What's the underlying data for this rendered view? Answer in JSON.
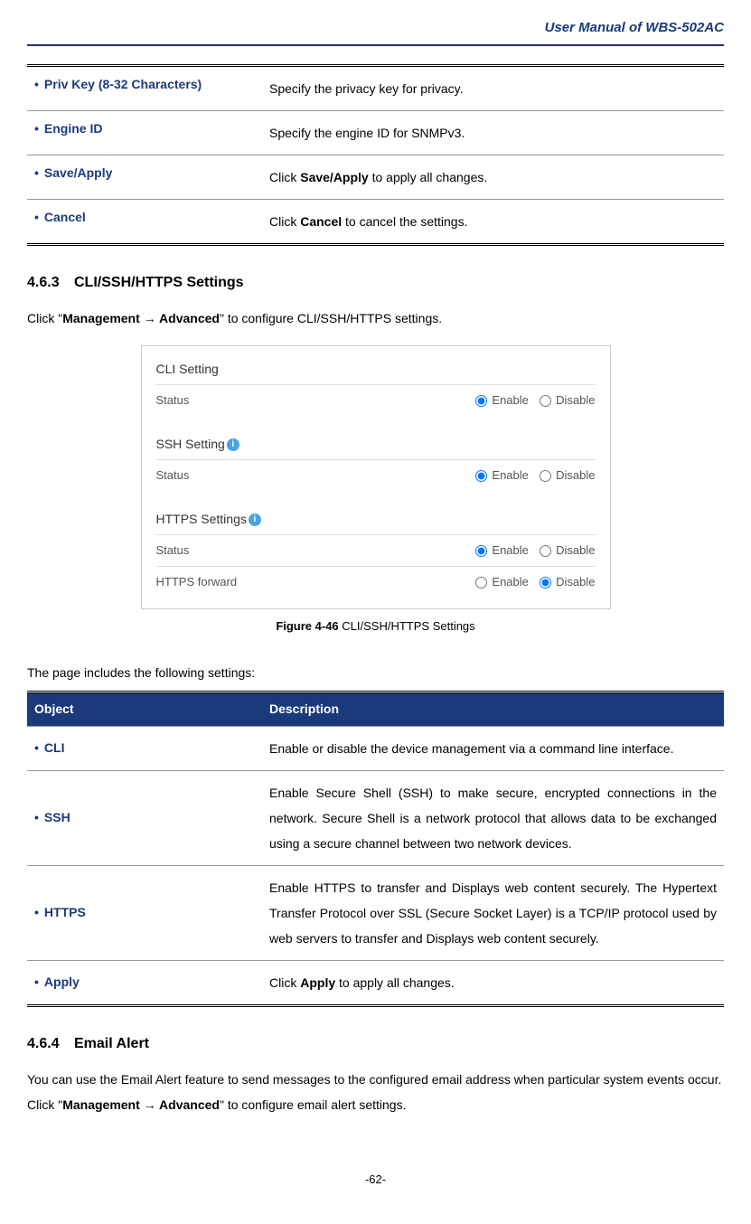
{
  "header": {
    "title": "User Manual of WBS-502AC"
  },
  "topTable": {
    "rows": [
      {
        "obj": "Priv Key (8-32 Characters)",
        "desc_pre": "Specify the privacy key for privacy.",
        "desc_bold": "",
        "desc_post": ""
      },
      {
        "obj": "Engine ID",
        "desc_pre": "Specify the engine ID for SNMPv3.",
        "desc_bold": "",
        "desc_post": ""
      },
      {
        "obj": "Save/Apply",
        "desc_pre": "Click ",
        "desc_bold": "Save/Apply",
        "desc_post": " to apply all changes."
      },
      {
        "obj": "Cancel",
        "desc_pre": "Click ",
        "desc_bold": "Cancel",
        "desc_post": " to cancel the settings."
      }
    ]
  },
  "section463": {
    "num": "4.6.3",
    "title": "CLI/SSH/HTTPS Settings",
    "intro_pre": "Click \"",
    "intro_nav1": "Management ",
    "intro_arrow": "→",
    "intro_nav2": " Advanced",
    "intro_post": "\" to configure CLI/SSH/HTTPS settings."
  },
  "figure": {
    "cli_title": "CLI Setting",
    "ssh_title": "SSH Setting",
    "https_title": "HTTPS Settings",
    "status_label": "Status",
    "forward_label": "HTTPS forward",
    "enable": "Enable",
    "disable": "Disable",
    "caption_bold": "Figure 4-46",
    "caption_rest": " CLI/SSH/HTTPS Settings"
  },
  "settingsIntro": "The page includes the following settings:",
  "objTable": {
    "h1": "Object",
    "h2": "Description",
    "rows": [
      {
        "obj": "CLI",
        "desc_pre": "Enable or disable the device management via a command line interface.",
        "desc_bold": "",
        "desc_post": ""
      },
      {
        "obj": "SSH",
        "desc_pre": "Enable Secure Shell (SSH) to make secure, encrypted connections in the network. Secure Shell is a network protocol that allows data to be exchanged using a secure channel between two network devices.",
        "desc_bold": "",
        "desc_post": ""
      },
      {
        "obj": "HTTPS",
        "desc_pre": "Enable HTTPS to transfer and Displays web content securely. The Hypertext Transfer Protocol over SSL (Secure Socket Layer) is a TCP/IP protocol used by web servers to transfer and Displays web content securely.",
        "desc_bold": "",
        "desc_post": ""
      },
      {
        "obj": "Apply",
        "desc_pre": "Click ",
        "desc_bold": "Apply",
        "desc_post": " to apply all changes."
      }
    ]
  },
  "section464": {
    "num": "4.6.4",
    "title": "Email Alert",
    "p_pre": "You can use the Email Alert feature to send messages to the configured email address when particular system events occur. Click \"",
    "nav1": "Management ",
    "arrow": "→",
    "nav2": " Advanced",
    "p_post": "\" to configure email alert settings."
  },
  "pageNum": "-62-"
}
